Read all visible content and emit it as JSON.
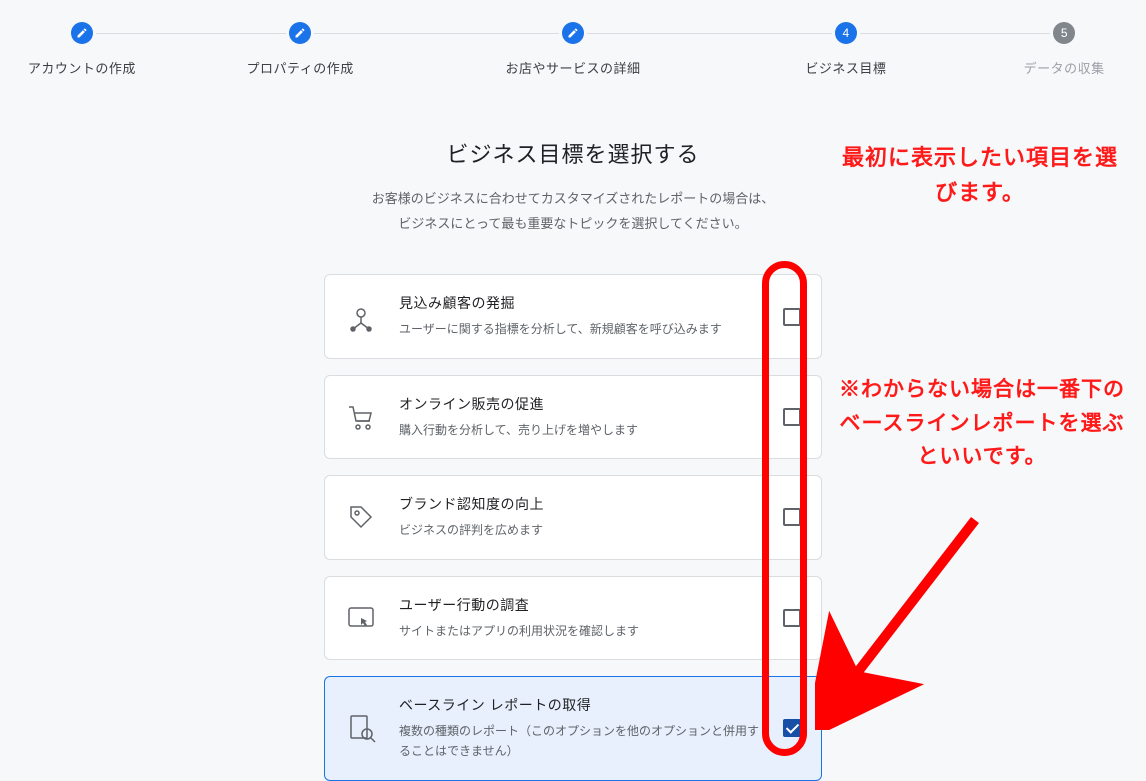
{
  "stepper": {
    "steps": [
      {
        "label": "アカウントの作成",
        "state": "done"
      },
      {
        "label": "プロパティの作成",
        "state": "done"
      },
      {
        "label": "お店やサービスの詳細",
        "state": "done"
      },
      {
        "label": "ビジネス目標",
        "state": "active",
        "number": "4"
      },
      {
        "label": "データの収集",
        "state": "future",
        "number": "5"
      }
    ]
  },
  "heading": "ビジネス目標を選択する",
  "subheading_line1": "お客様のビジネスに合わせてカスタマイズされたレポートの場合は、",
  "subheading_line2": "ビジネスにとって最も重要なトピックを選択してください。",
  "options": [
    {
      "id": "leads",
      "title": "見込み顧客の発掘",
      "desc": "ユーザーに関する指標を分析して、新規顧客を呼び込みます",
      "checked": false
    },
    {
      "id": "sales",
      "title": "オンライン販売の促進",
      "desc": "購入行動を分析して、売り上げを増やします",
      "checked": false
    },
    {
      "id": "brand",
      "title": "ブランド認知度の向上",
      "desc": "ビジネスの評判を広めます",
      "checked": false
    },
    {
      "id": "behavior",
      "title": "ユーザー行動の調査",
      "desc": "サイトまたはアプリの利用状況を確認します",
      "checked": false
    },
    {
      "id": "baseline",
      "title": "ベースライン レポートの取得",
      "desc": "複数の種類のレポート（このオプションを他のオプションと併用することはできません）",
      "checked": true
    }
  ],
  "annotations": {
    "top_text": "最初に表示したい項目を選びます。",
    "mid_text": "※わからない場合は一番下のベースラインレポートを選ぶといいです。"
  }
}
